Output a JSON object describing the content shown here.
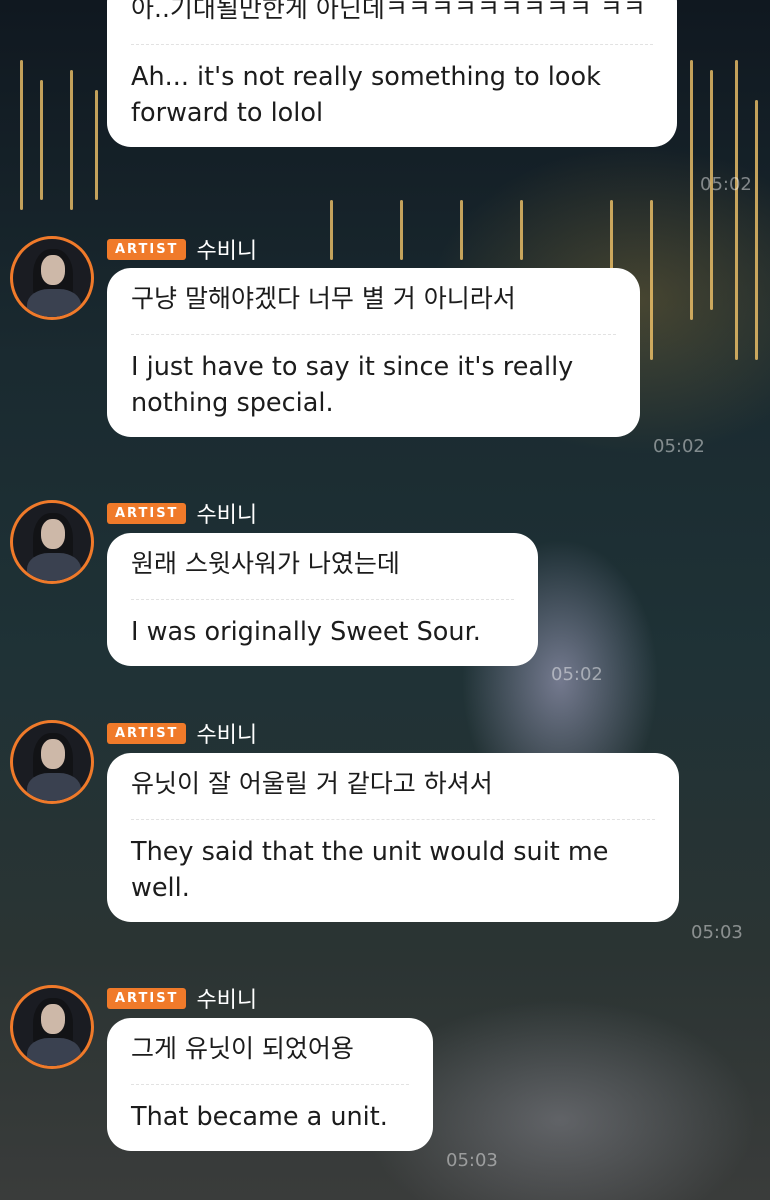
{
  "messages": [
    {
      "partial_top": true,
      "korean": "아..기대될만한게 아닌데ㅋㅋㅋㅋㅋㅋㅋㅋㅋ ㅋㅋ",
      "english": "Ah... it's not really something to look forward to lolol",
      "time": "05:02"
    },
    {
      "badge": "ARTIST",
      "name": "수비니",
      "korean": "구냥 말해야겠다 너무 별 거 아니라서",
      "english": "I just have to say it since it's really nothing special.",
      "time": "05:02"
    },
    {
      "badge": "ARTIST",
      "name": "수비니",
      "korean": "원래 스윗사워가 나였는데",
      "english": "I was originally Sweet Sour.",
      "time": "05:02"
    },
    {
      "badge": "ARTIST",
      "name": "수비니",
      "korean": "유닛이 잘 어울릴 거 같다고 하셔서",
      "english": "They said that the unit would suit me well.",
      "time": "05:03"
    },
    {
      "badge": "ARTIST",
      "name": "수비니",
      "korean": "그게 유닛이 되었어용",
      "english": "That became a unit.",
      "time": "05:03"
    }
  ]
}
